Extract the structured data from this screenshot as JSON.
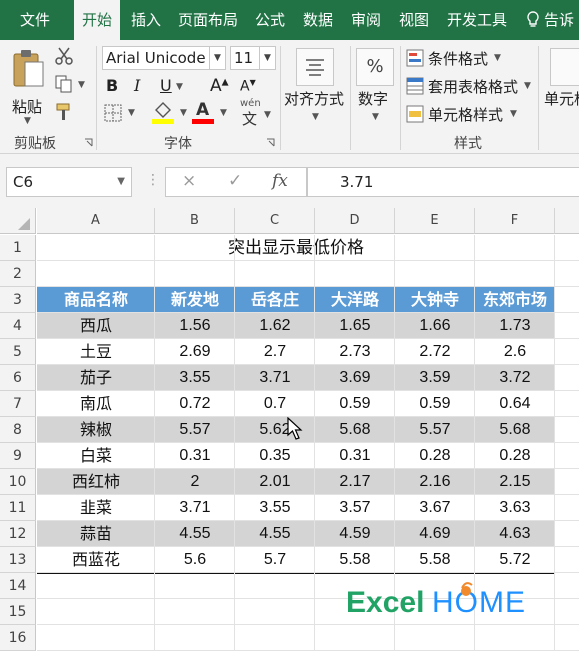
{
  "menu": {
    "tabs": [
      {
        "label": "文件",
        "active": false
      },
      {
        "label": "开始",
        "active": true
      },
      {
        "label": "插入",
        "active": false
      },
      {
        "label": "页面布局",
        "active": false
      },
      {
        "label": "公式",
        "active": false
      },
      {
        "label": "数据",
        "active": false
      },
      {
        "label": "审阅",
        "active": false
      },
      {
        "label": "视图",
        "active": false
      },
      {
        "label": "开发工具",
        "active": false
      }
    ],
    "tell_me": "告诉"
  },
  "ribbon": {
    "clipboard": {
      "label": "剪贴板",
      "paste_label": "粘贴"
    },
    "font": {
      "label": "字体",
      "name": "Arial Unicode M",
      "size": "11",
      "bold": "B",
      "italic": "I",
      "underline": "U",
      "grow": "A",
      "shrink": "A",
      "font_color_letter": "A",
      "wen": "wén",
      "wen_char": "文"
    },
    "alignment": {
      "label": "对齐方式"
    },
    "number": {
      "label": "数字",
      "icon_text": "%"
    },
    "styles": {
      "label": "样式",
      "conditional": "条件格式",
      "table_format": "套用表格格式",
      "cell_styles": "单元格样式"
    },
    "cells": {
      "label": "单元格"
    },
    "colors": {
      "accent": "#217346",
      "fill_highlight": "#ffff00",
      "font_red": "#ff0000"
    }
  },
  "formula_bar": {
    "name_box": "C6",
    "cancel": "×",
    "enter": "✓",
    "fx": "fx",
    "value": "3.71"
  },
  "sheet": {
    "columns": [
      "A",
      "B",
      "C",
      "D",
      "E",
      "F"
    ],
    "rows": [
      "1",
      "2",
      "3",
      "4",
      "5",
      "6",
      "7",
      "8",
      "9",
      "10",
      "11",
      "12",
      "13",
      "14",
      "15",
      "16"
    ],
    "title": "突出显示最低价格",
    "headers": [
      "商品名称",
      "新发地",
      "岳各庄",
      "大洋路",
      "大钟寺",
      "东郊市场"
    ],
    "data": [
      [
        "西瓜",
        "1.56",
        "1.62",
        "1.65",
        "1.66",
        "1.73"
      ],
      [
        "土豆",
        "2.69",
        "2.7",
        "2.73",
        "2.72",
        "2.6"
      ],
      [
        "茄子",
        "3.55",
        "3.71",
        "3.69",
        "3.59",
        "3.72"
      ],
      [
        "南瓜",
        "0.72",
        "0.7",
        "0.59",
        "0.59",
        "0.64"
      ],
      [
        "辣椒",
        "5.57",
        "5.62",
        "5.68",
        "5.57",
        "5.68"
      ],
      [
        "白菜",
        "0.31",
        "0.35",
        "0.31",
        "0.28",
        "0.28"
      ],
      [
        "西红柿",
        "2",
        "2.01",
        "2.17",
        "2.16",
        "2.15"
      ],
      [
        "韭菜",
        "3.71",
        "3.55",
        "3.57",
        "3.67",
        "3.63"
      ],
      [
        "蒜苗",
        "4.55",
        "4.55",
        "4.59",
        "4.69",
        "4.63"
      ],
      [
        "西蓝花",
        "5.6",
        "5.7",
        "5.58",
        "5.58",
        "5.72"
      ]
    ],
    "colors": {
      "header_bg": "#5b9bd5",
      "band_bg": "#d4d4d4"
    }
  },
  "logo": {
    "text_a": "Excel",
    "text_b": "HOME",
    "color_a": "#21a366",
    "color_b": "#1e90ff"
  }
}
